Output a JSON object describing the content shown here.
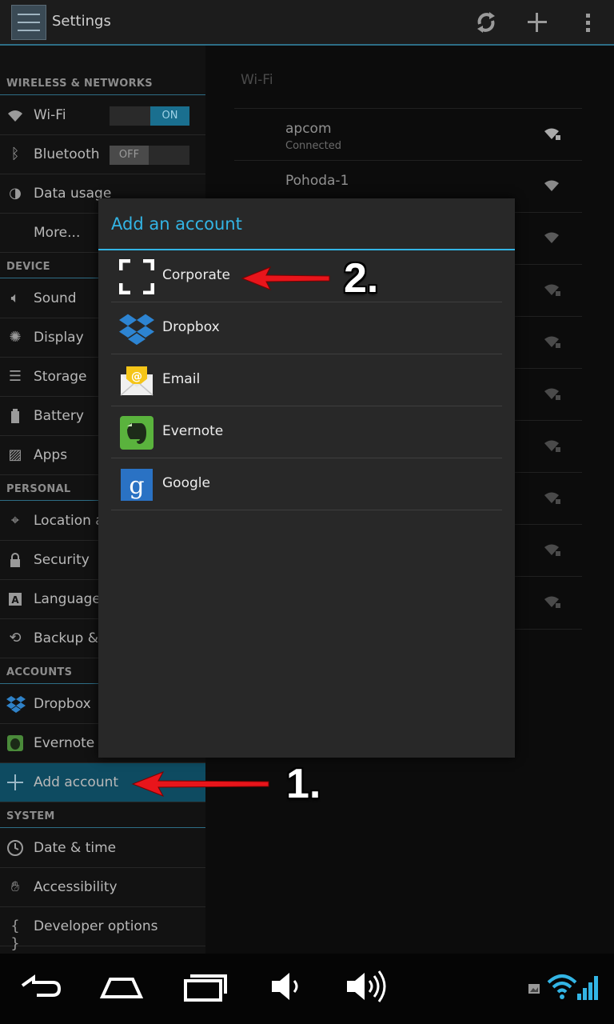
{
  "action_bar": {
    "title": "Settings",
    "icons": [
      "settings-app-icon",
      "sync-icon",
      "add-icon",
      "overflow-menu-icon"
    ]
  },
  "sidebar": {
    "sections": [
      {
        "label": "WIRELESS & NETWORKS"
      },
      {
        "label": "DEVICE"
      },
      {
        "label": "PERSONAL"
      },
      {
        "label": "ACCOUNTS"
      },
      {
        "label": "SYSTEM"
      }
    ],
    "items": [
      {
        "label": "Wi-Fi",
        "icon": "wifi-icon",
        "toggle": "ON"
      },
      {
        "label": "Bluetooth",
        "icon": "bluetooth-icon",
        "toggle": "OFF"
      },
      {
        "label": "Data usage",
        "icon": "data-usage-icon"
      },
      {
        "label": "More..."
      },
      {
        "label": "Sound",
        "icon": "sound-icon"
      },
      {
        "label": "Display",
        "icon": "display-icon"
      },
      {
        "label": "Storage",
        "icon": "storage-icon"
      },
      {
        "label": "Battery",
        "icon": "battery-icon"
      },
      {
        "label": "Apps",
        "icon": "apps-icon"
      },
      {
        "label": "Location a",
        "icon": "location-icon"
      },
      {
        "label": "Security",
        "icon": "lock-icon"
      },
      {
        "label": "Language",
        "icon": "language-icon"
      },
      {
        "label": "Backup & r",
        "icon": "backup-icon"
      },
      {
        "label": "Dropbox",
        "icon": "dropbox-icon"
      },
      {
        "label": "Evernote",
        "icon": "evernote-icon"
      },
      {
        "label": "Add account",
        "icon": "plus-icon"
      },
      {
        "label": "Date & time",
        "icon": "clock-icon"
      },
      {
        "label": "Accessibility",
        "icon": "hand-icon"
      },
      {
        "label": "Developer options",
        "icon": "braces-icon"
      }
    ]
  },
  "wifi_panel": {
    "header": "Wi-Fi",
    "networks": [
      {
        "name": "apcom",
        "status": "Connected"
      },
      {
        "name": "Pohoda-1",
        "status": ""
      }
    ]
  },
  "dialog": {
    "title": "Add an account",
    "accounts": [
      {
        "label": "Corporate",
        "icon": "corporate-icon"
      },
      {
        "label": "Dropbox",
        "icon": "dropbox-icon"
      },
      {
        "label": "Email",
        "icon": "email-icon"
      },
      {
        "label": "Evernote",
        "icon": "evernote-icon"
      },
      {
        "label": "Google",
        "icon": "google-icon"
      }
    ]
  },
  "annotations": {
    "step1": "1.",
    "step2": "2."
  },
  "nav_bar": {
    "buttons": [
      "back-icon",
      "home-icon",
      "recent-apps-icon",
      "volume-down-icon",
      "volume-up-icon"
    ],
    "status_icons": [
      "screenshot-icon",
      "wifi-status-icon",
      "signal-icon"
    ]
  },
  "colors": {
    "accent": "#33b5e5",
    "selected": "#0e4b61",
    "annotation_arrow": "#e8151b"
  }
}
